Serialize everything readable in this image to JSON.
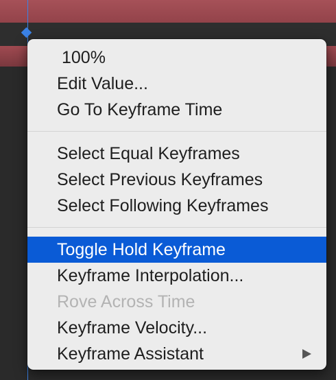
{
  "menu": {
    "group1": [
      {
        "label": "100%"
      },
      {
        "label": "Edit Value..."
      },
      {
        "label": "Go To Keyframe Time"
      }
    ],
    "group2": [
      {
        "label": "Select Equal Keyframes"
      },
      {
        "label": "Select Previous Keyframes"
      },
      {
        "label": "Select Following Keyframes"
      }
    ],
    "group3": [
      {
        "label": "Toggle Hold Keyframe",
        "state": "highlighted"
      },
      {
        "label": "Keyframe Interpolation..."
      },
      {
        "label": "Rove Across Time",
        "state": "disabled"
      },
      {
        "label": "Keyframe Velocity..."
      },
      {
        "label": "Keyframe Assistant",
        "submenu_icon": "triangle-right-icon"
      }
    ]
  },
  "colors": {
    "highlight": "#0a5bd6",
    "track_red": "#a65158",
    "playhead": "#3b82e6",
    "menu_bg": "#ececec"
  }
}
